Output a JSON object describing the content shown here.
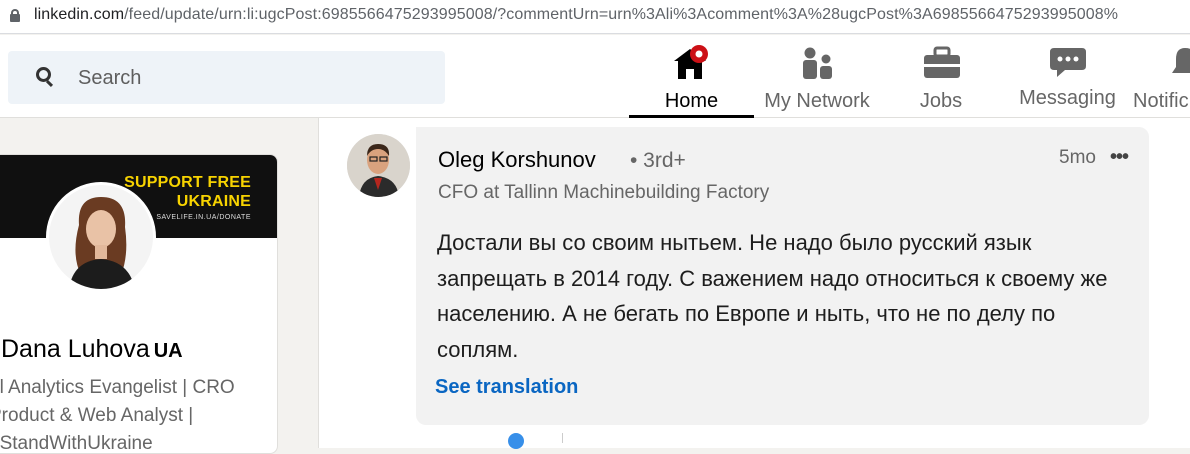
{
  "browser": {
    "url_host": "linkedin.com",
    "url_path": "/feed/update/urn:li:ugcPost:6985566475293995008/?commentUrn=urn%3Ali%3Acomment%3A%28ugcPost%3A6985566475293995008%"
  },
  "header": {
    "search_placeholder": "Search",
    "nav": {
      "home": "Home",
      "network": "My Network",
      "jobs": "Jobs",
      "messaging": "Messaging",
      "notifications": "Notific"
    },
    "icons": {
      "home": "home-icon",
      "network": "people-icon",
      "jobs": "briefcase-icon",
      "messaging": "chat-bubble-icon",
      "notifications": "bell-icon"
    },
    "home_badge_color": "#cc1016"
  },
  "profile": {
    "banner_line1": "SUPPORT FREE",
    "banner_line2": "UKRAINE",
    "banner_line3": "SAVELIFE.IN.UA/DONATE",
    "name": "Dana Luhova",
    "name_badge": "UA",
    "headline_line1": "al Analytics Evangelist | CRO",
    "headline_line2": "Product & Web Analyst |",
    "headline_line3": "#StandWithUkraine"
  },
  "comment": {
    "author": "Oleg Korshunov",
    "degree": "• 3rd+",
    "author_title": "CFO at Tallinn Machinebuilding Factory",
    "time": "5mo",
    "more": "•••",
    "text": "Достали вы со своим нытьем. Не надо было русский язык запрещать в 2014 году. С важением надо относиться к своему же населению. А не бегать по Европе и ныть, что не по делу по соплям.",
    "translate_label": "See translation"
  }
}
